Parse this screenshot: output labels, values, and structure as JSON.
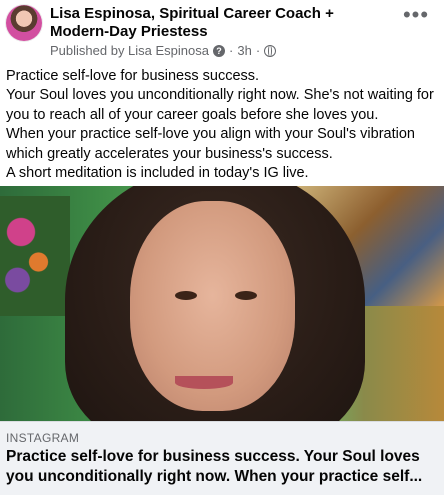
{
  "post": {
    "author": "Lisa Espinosa, Spiritual Career Coach + Modern-Day Priestess",
    "published_by": "Published by Lisa Espinosa",
    "separator": "·",
    "time": "3h",
    "separator2": "·",
    "more_label": "•••",
    "text": [
      "Practice self-love for business success.",
      "Your Soul loves you unconditionally right now. She's not waiting for you to reach all of your career goals before she loves you.",
      "When your practice self-love you align with your Soul's vibration which greatly accelerates your business's success.",
      "A short meditation is included in today's IG live."
    ]
  },
  "link_preview": {
    "source": "INSTAGRAM",
    "title": "Practice self-love for business success. Your Soul loves you unconditionally right now. When your practice self..."
  },
  "icons": {
    "help": "help-icon",
    "privacy": "globe-icon",
    "more": "more-options-icon"
  },
  "colors": {
    "text": "#050505",
    "secondary": "#65676b",
    "link_box_bg": "#f0f2f5"
  }
}
